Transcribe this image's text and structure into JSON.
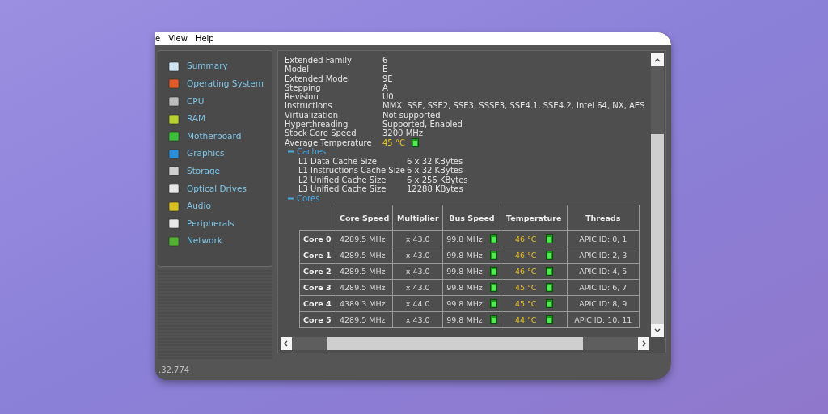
{
  "menu": [
    {
      "label": "e"
    },
    {
      "label": "View"
    },
    {
      "label": "Help"
    }
  ],
  "sidebar": {
    "items": [
      {
        "label": "Summary"
      },
      {
        "label": "Operating System"
      },
      {
        "label": "CPU"
      },
      {
        "label": "RAM"
      },
      {
        "label": "Motherboard"
      },
      {
        "label": "Graphics"
      },
      {
        "label": "Storage"
      },
      {
        "label": "Optical Drives"
      },
      {
        "label": "Audio"
      },
      {
        "label": "Peripherals"
      },
      {
        "label": "Network"
      }
    ]
  },
  "properties": [
    {
      "label": "Extended Family",
      "value": "6",
      "kind": "text"
    },
    {
      "label": "Model",
      "value": "E",
      "kind": "text"
    },
    {
      "label": "Extended Model",
      "value": "9E",
      "kind": "text"
    },
    {
      "label": "Stepping",
      "value": "A",
      "kind": "text"
    },
    {
      "label": "Revision",
      "value": "U0",
      "kind": "text"
    },
    {
      "label": "Instructions",
      "value": "MMX, SSE, SSE2, SSE3, SSSE3, SSE4.1, SSE4.2, Intel 64, NX, AES",
      "kind": "text"
    },
    {
      "label": "Virtualization",
      "value": "Not supported",
      "kind": "text"
    },
    {
      "label": "Hyperthreading",
      "value": "Supported, Enabled",
      "kind": "text"
    },
    {
      "label": "Stock Core Speed",
      "value": "3200 MHz",
      "kind": "text"
    },
    {
      "label": "Average Temperature",
      "value": "45 °C",
      "kind": "temperature"
    }
  ],
  "caches": {
    "title": "Caches",
    "expanded": true,
    "items": [
      {
        "label": "L1 Data Cache Size",
        "value": "6 x 32 KBytes"
      },
      {
        "label": "L1 Instructions Cache Size",
        "value": "6 x 32 KBytes"
      },
      {
        "label": "L2 Unified Cache Size",
        "value": "6 x 256 KBytes"
      },
      {
        "label": "L3 Unified Cache Size",
        "value": "12288 KBytes"
      }
    ]
  },
  "cores": {
    "title": "Cores",
    "expanded": true,
    "columns": [
      "Core Speed",
      "Multiplier",
      "Bus Speed",
      "Temperature",
      "Threads"
    ],
    "rows": [
      {
        "name": "Core 0",
        "core_speed": "4289.5 MHz",
        "multiplier": "x 43.0",
        "bus_speed": "99.8 MHz",
        "temperature": "46 °C",
        "threads": "APIC ID: 0, 1"
      },
      {
        "name": "Core 1",
        "core_speed": "4289.5 MHz",
        "multiplier": "x 43.0",
        "bus_speed": "99.8 MHz",
        "temperature": "46 °C",
        "threads": "APIC ID: 2, 3"
      },
      {
        "name": "Core 2",
        "core_speed": "4289.5 MHz",
        "multiplier": "x 43.0",
        "bus_speed": "99.8 MHz",
        "temperature": "46 °C",
        "threads": "APIC ID: 4, 5"
      },
      {
        "name": "Core 3",
        "core_speed": "4289.5 MHz",
        "multiplier": "x 43.0",
        "bus_speed": "99.8 MHz",
        "temperature": "45 °C",
        "threads": "APIC ID: 6, 7"
      },
      {
        "name": "Core 4",
        "core_speed": "4389.3 MHz",
        "multiplier": "x 44.0",
        "bus_speed": "99.8 MHz",
        "temperature": "45 °C",
        "threads": "APIC ID: 8, 9"
      },
      {
        "name": "Core 5",
        "core_speed": "4289.5 MHz",
        "multiplier": "x 43.0",
        "bus_speed": "99.8 MHz",
        "temperature": "44 °C",
        "threads": "APIC ID: 10, 11"
      }
    ]
  },
  "status_bar": {
    "text": ".32.774"
  }
}
